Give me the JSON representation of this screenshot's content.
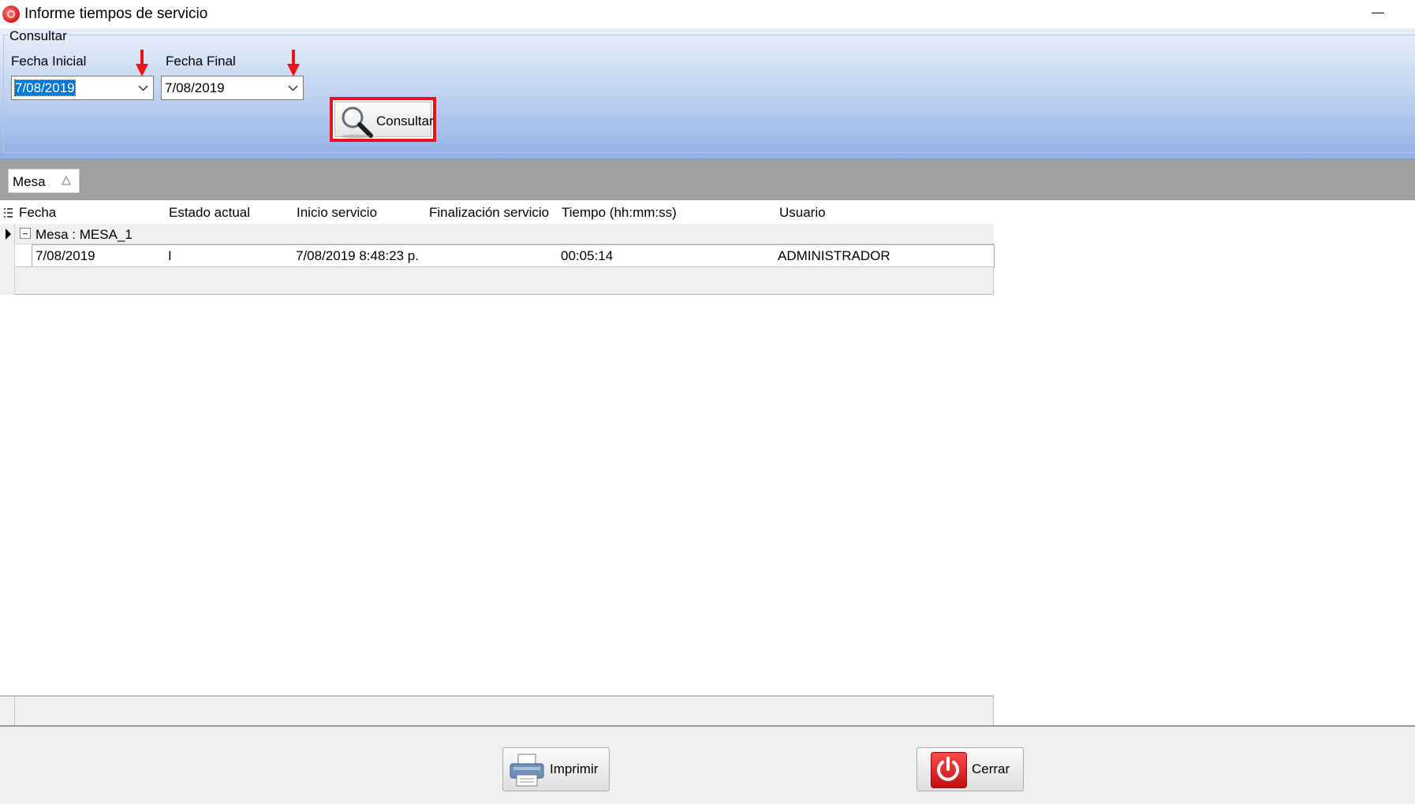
{
  "window": {
    "title": "Informe tiempos de servicio"
  },
  "query": {
    "group_label": "Consultar",
    "fecha_inicial_label": "Fecha Inicial",
    "fecha_inicial_value": "7/08/2019",
    "fecha_final_label": "Fecha Final",
    "fecha_final_value": "7/08/2019",
    "consultar_label": "Consultar"
  },
  "groupby": {
    "chip_label": "Mesa",
    "sort": "ascending"
  },
  "grid": {
    "columns": [
      "Fecha",
      "Estado actual",
      "Inicio servicio",
      "Finalización servicio",
      "Tiempo (hh:mm:ss)",
      "Usuario"
    ],
    "group_row_label": "Mesa : MESA_1",
    "rows": [
      [
        "7/08/2019",
        "I",
        "7/08/2019 8:48:23 p.",
        "",
        "00:05:14",
        "ADMINISTRADOR"
      ]
    ]
  },
  "footer": {
    "imprimir_label": "Imprimir",
    "cerrar_label": "Cerrar"
  },
  "colors": {
    "highlight_red": "#e8141b",
    "selection_blue": "#0078d7",
    "panel_blue": "#a9c3ec"
  }
}
